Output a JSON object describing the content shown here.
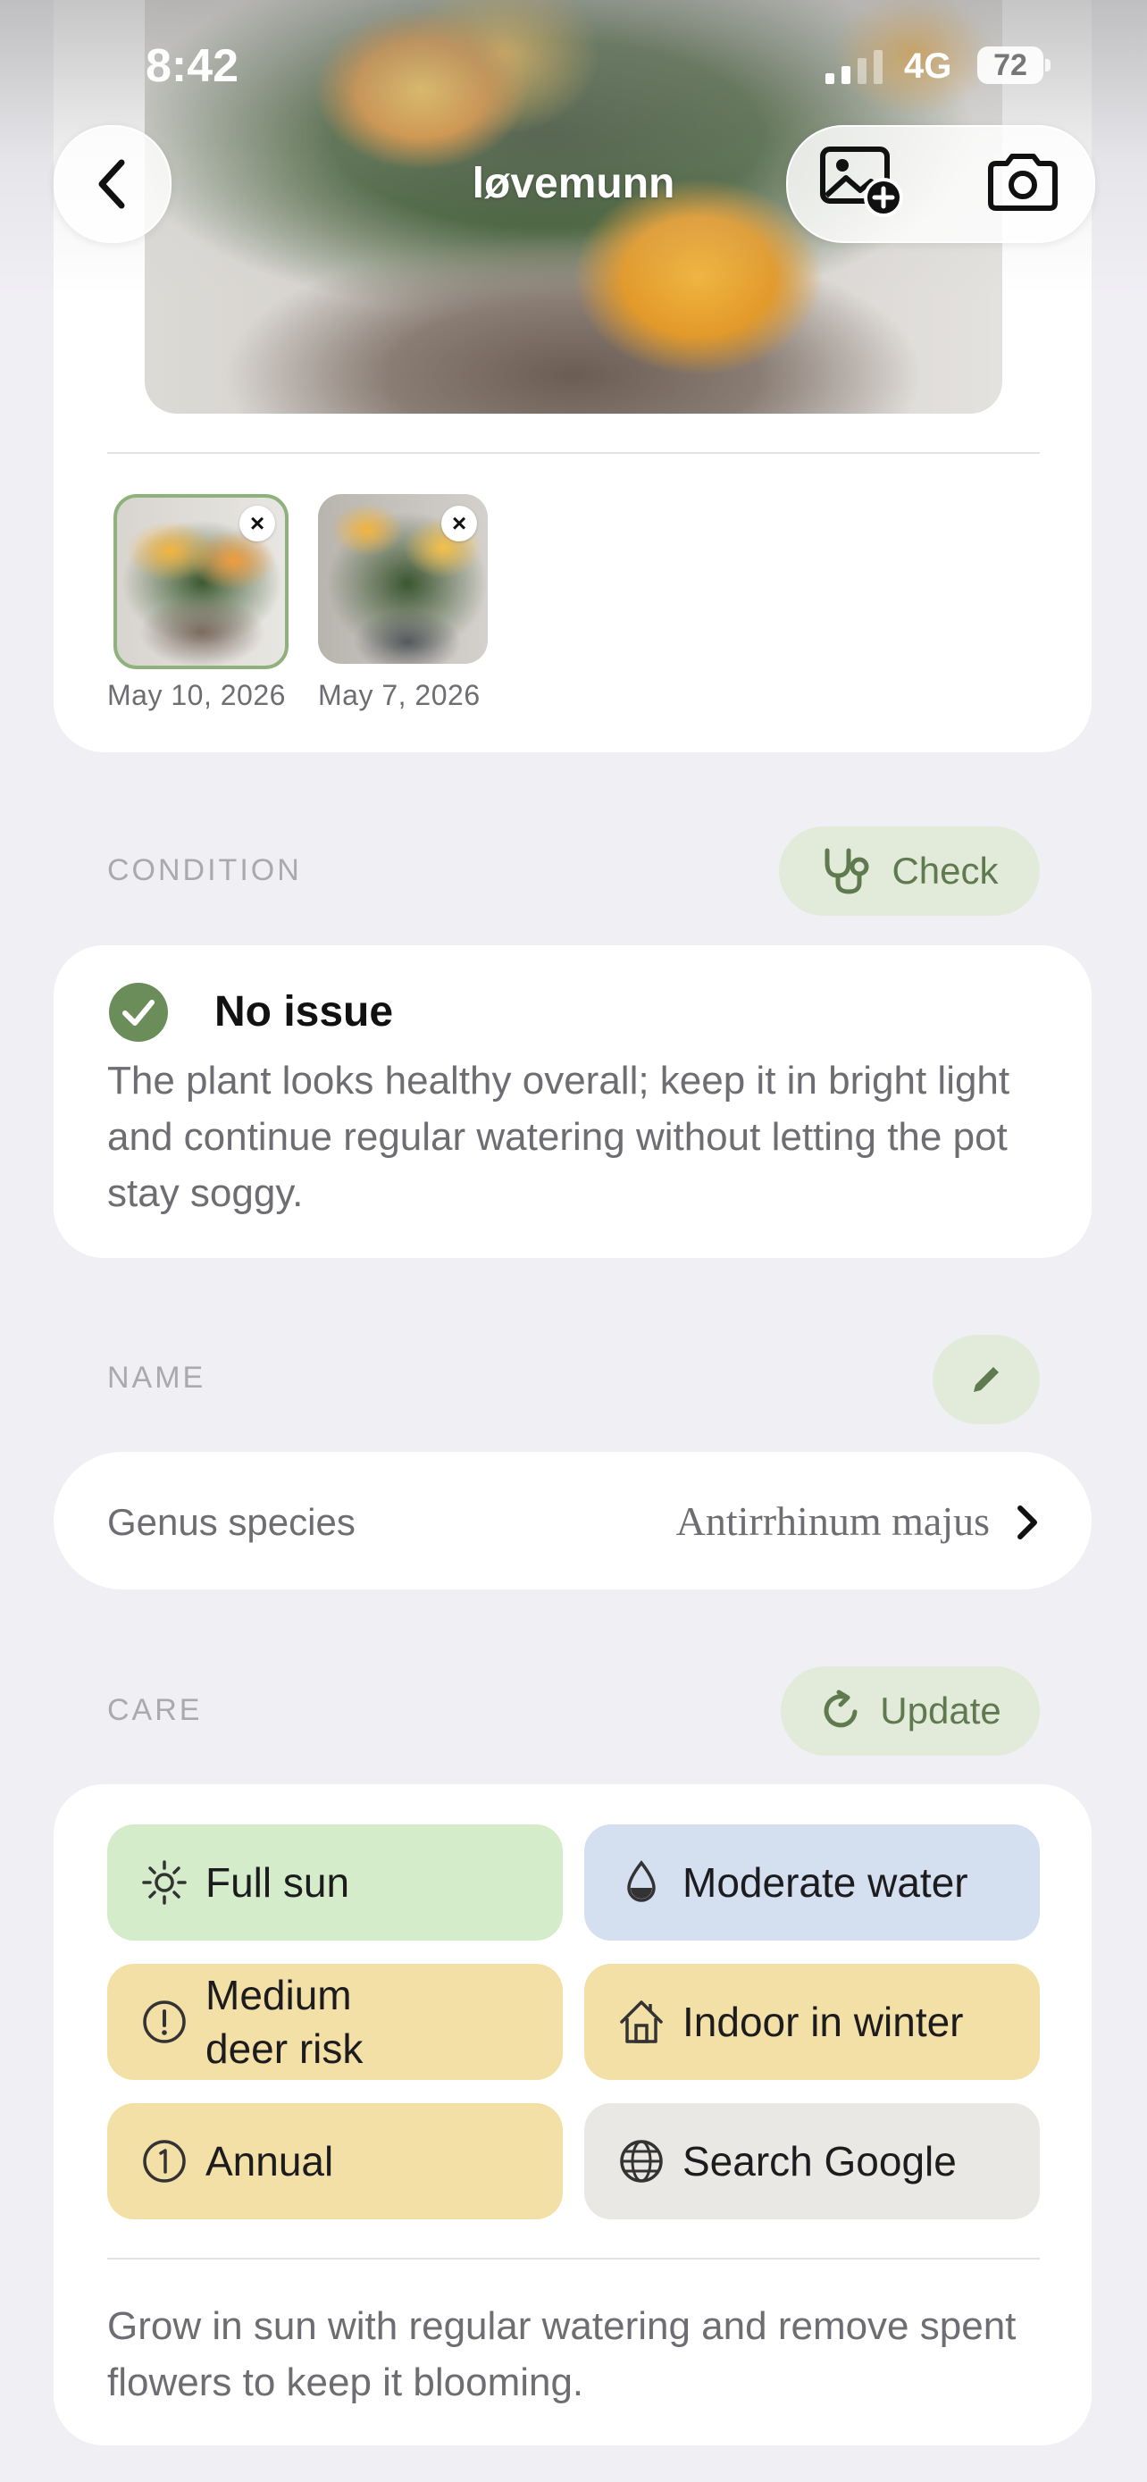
{
  "status_bar": {
    "time": "8:42",
    "network": "4G",
    "battery": "72"
  },
  "header": {
    "title": "løvemunn"
  },
  "icons": {
    "back": "chevron-left-icon",
    "add_photo": "photo-add-icon",
    "camera": "camera-icon",
    "check": "stethoscope-icon",
    "edit": "pencil-icon",
    "update": "refresh-icon",
    "ok": "checkmark-circle-icon",
    "chevron": "chevron-right-icon"
  },
  "photos": [
    {
      "date": "May 10, 2026",
      "selected": true
    },
    {
      "date": "May 7, 2026",
      "selected": false
    }
  ],
  "photo_remove_glyph": "×",
  "condition": {
    "label": "CONDITION",
    "check_label": "Check",
    "status": "No issue",
    "description": "The plant looks healthy overall; keep it in bright light and continue regular watering without letting the pot stay soggy."
  },
  "name": {
    "label": "NAME",
    "key": "Genus species",
    "value": "Antirrhinum majus"
  },
  "care": {
    "label": "CARE",
    "update_label": "Update",
    "chips": [
      {
        "label": "Full sun",
        "icon": "sun-icon",
        "color": "#d5eccb"
      },
      {
        "label": "Moderate water",
        "icon": "water-drop-icon",
        "color": "#d4dff0"
      },
      {
        "label_line1": "Medium",
        "label_line2": "deer risk",
        "icon": "warning-circle-icon",
        "color": "#f3e0a6"
      },
      {
        "label": "Indoor in winter",
        "icon": "house-icon",
        "color": "#f3e0a6"
      },
      {
        "label": "Annual",
        "icon": "number-one-circle-icon",
        "color": "#f3e0a6"
      },
      {
        "label": "Search Google",
        "icon": "globe-icon",
        "color": "#e9e8e4"
      }
    ],
    "description": "Grow in sun with regular watering and remove spent flowers to keep it blooming."
  },
  "colors": {
    "accent": "#5e7a4e",
    "accent_bg": "#e2ebda",
    "ok_green": "#6b8d5a",
    "background": "#f0eff4"
  }
}
